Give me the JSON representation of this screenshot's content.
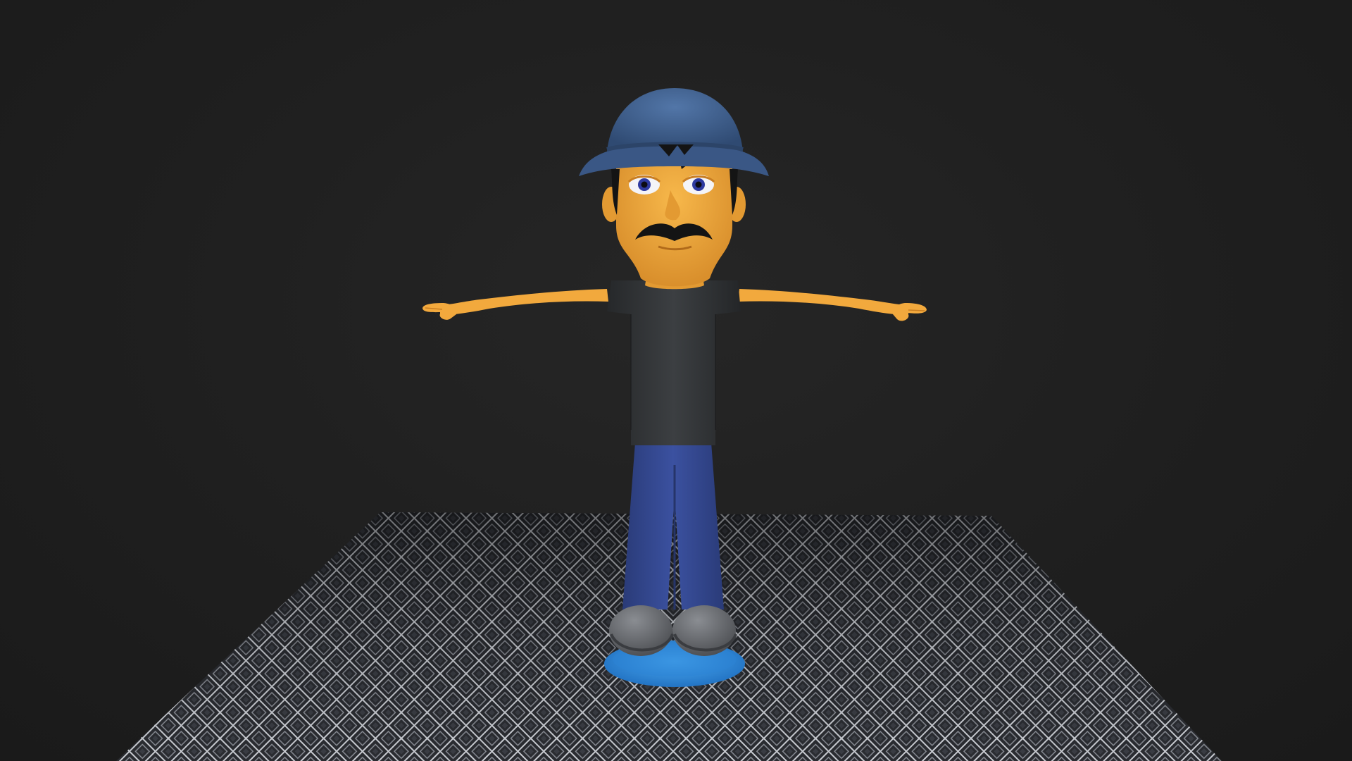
{
  "scene": {
    "subject": "character-model",
    "pose": "t-pose",
    "colors": {
      "background": "#1e1e1e",
      "skin": "#f2a93d",
      "skin_shadow": "#c97e22",
      "hat": "#3f5f8c",
      "hat_shadow": "#2c4468",
      "shirt": "#2f3133",
      "shirt_highlight": "#46494c",
      "pants": "#33478a",
      "pants_shadow": "#26356a",
      "shoes": "#6c6f73",
      "hair": "#141414",
      "base_disc": "#2f8fe0",
      "floor_dark": "#2a2c31",
      "floor_line": "#c9ccd2"
    },
    "icons": [
      "floor-grid",
      "base-disc"
    ]
  }
}
